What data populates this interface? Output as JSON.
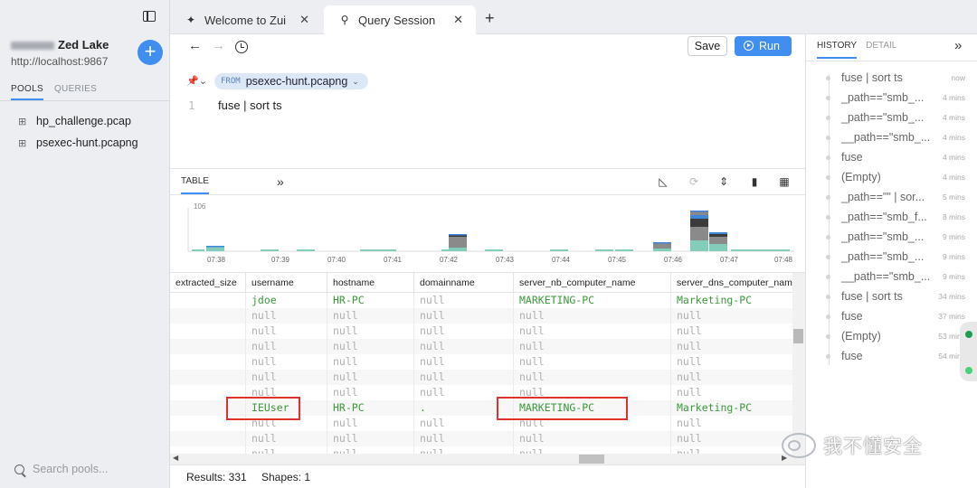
{
  "sidebar": {
    "lake_name": "Zed Lake",
    "lake_url": "http://localhost:9867",
    "add_label": "+",
    "tabs": [
      {
        "label": "POOLS"
      },
      {
        "label": "QUERIES"
      }
    ],
    "pools": [
      {
        "name": "hp_challenge.pcap"
      },
      {
        "name": "psexec-hunt.pcapng"
      }
    ],
    "search_placeholder": "Search pools..."
  },
  "tabs": [
    {
      "label": "Welcome to Zui",
      "icon": "zui-logo-icon"
    },
    {
      "label": "Query Session",
      "icon": "search-icon"
    }
  ],
  "toolbar": {
    "save_label": "Save",
    "run_label": "Run"
  },
  "editor": {
    "from_keyword": "FROM",
    "pool": "psexec-hunt.pcapng",
    "line_number": "1",
    "query": "fuse | sort ts"
  },
  "results": {
    "tab_label": "TABLE",
    "expand_label": "»",
    "count_text": "Results: 331",
    "shapes_text": "Shapes: 1"
  },
  "histogram": {
    "y_max_label": "106",
    "ticks": [
      "07:38",
      "07:39",
      "07:40",
      "07:41",
      "07:42",
      "07:43",
      "07:44",
      "07:45",
      "07:46",
      "07:47",
      "07:48"
    ],
    "colors": {
      "base": "#84cdbb",
      "mid": "#8a8a8a",
      "top": "#3f86d8",
      "dark": "#3b3b3b"
    }
  },
  "table": {
    "columns": [
      "extracted_size",
      "username",
      "hostname",
      "domainname",
      "server_nb_computer_name",
      "server_dns_computer_name"
    ],
    "rows": [
      [
        "",
        "jdoe",
        "HR-PC",
        "null",
        "MARKETING-PC",
        "Marketing-PC"
      ],
      [
        "",
        "null",
        "null",
        "null",
        "null",
        "null"
      ],
      [
        "",
        "null",
        "null",
        "null",
        "null",
        "null"
      ],
      [
        "",
        "null",
        "null",
        "null",
        "null",
        "null"
      ],
      [
        "",
        "null",
        "null",
        "null",
        "null",
        "null"
      ],
      [
        "",
        "null",
        "null",
        "null",
        "null",
        "null"
      ],
      [
        "",
        "null",
        "null",
        "null",
        "null",
        "null"
      ],
      [
        "",
        "IEUser",
        "HR-PC",
        ".",
        "MARKETING-PC",
        "Marketing-PC"
      ],
      [
        "",
        "null",
        "null",
        "null",
        "null",
        "null"
      ],
      [
        "",
        "null",
        "null",
        "null",
        "null",
        "null"
      ],
      [
        "",
        "null",
        "null",
        "null",
        "null",
        "null"
      ]
    ]
  },
  "right_panel": {
    "tabs": [
      {
        "label": "HISTORY"
      },
      {
        "label": "DETAIL"
      }
    ],
    "history": [
      {
        "query": "fuse | sort ts",
        "when": "now"
      },
      {
        "query": "_path==\"smb_...",
        "when": "4 mins"
      },
      {
        "query": "_path==\"smb_...",
        "when": "4 mins"
      },
      {
        "query": "__path==\"smb_...",
        "when": "4 mins"
      },
      {
        "query": "fuse",
        "when": "4 mins"
      },
      {
        "query": "(Empty)",
        "when": "4 mins"
      },
      {
        "query": "_path==\"\" | sor...",
        "when": "5 mins"
      },
      {
        "query": "_path==\"smb_f...",
        "when": "8 mins"
      },
      {
        "query": "_path==\"smb_...",
        "when": "9 mins"
      },
      {
        "query": "_path==\"smb_...",
        "when": "9 mins"
      },
      {
        "query": "__path==\"smb_...",
        "when": "9 mins"
      },
      {
        "query": "fuse | sort ts",
        "when": "34 mins"
      },
      {
        "query": "fuse",
        "when": "37 mins"
      },
      {
        "query": "(Empty)",
        "when": "53 mins"
      },
      {
        "query": "fuse",
        "when": "54 mins"
      }
    ]
  },
  "watermark": {
    "text": "我不懂安全"
  }
}
